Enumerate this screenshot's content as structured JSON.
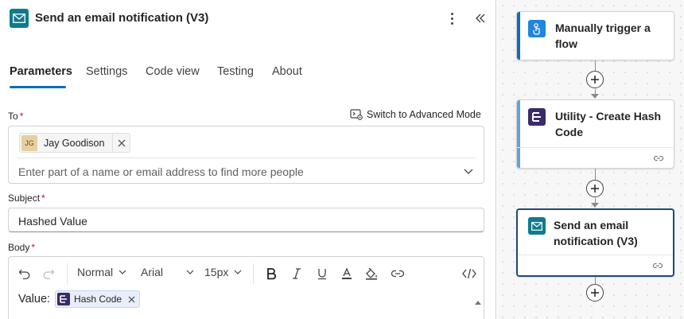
{
  "panel": {
    "title": "Send an email notification (V3)",
    "app_color": "#0f7b8c",
    "tabs": [
      {
        "label": "Parameters",
        "active": true
      },
      {
        "label": "Settings",
        "active": false
      },
      {
        "label": "Code view",
        "active": false
      },
      {
        "label": "Testing",
        "active": false
      },
      {
        "label": "About",
        "active": false
      }
    ],
    "advanced_mode_label": "Switch to Advanced Mode"
  },
  "fields": {
    "to": {
      "label": "To",
      "required_mark": "*",
      "recipients": [
        {
          "initials": "JG",
          "name": "Jay Goodison"
        }
      ],
      "placeholder": "Enter part of a name or email address to find more people"
    },
    "subject": {
      "label": "Subject",
      "required_mark": "*",
      "value": "Hashed Value"
    },
    "body": {
      "label": "Body",
      "required_mark": "*",
      "toolbar": {
        "paragraph_style": "Normal",
        "font_family": "Arial",
        "font_size": "15px"
      },
      "content_prefix": "Value:",
      "token_label": "Hash Code"
    }
  },
  "flow": {
    "cards": [
      {
        "title": "Manually trigger a flow",
        "accent": "#0f6cbd",
        "icon": "touch-icon",
        "icon_color": "#1f85de"
      },
      {
        "title": "Utility - Create Hash Code",
        "accent": "#5ea3e0",
        "icon": "utility-icon",
        "icon_color": "#3a2a6a"
      },
      {
        "title": "Send an email notification (V3)",
        "accent": "#0f7b8c",
        "icon": "mail-icon",
        "icon_color": "#0f7b8c"
      }
    ]
  }
}
